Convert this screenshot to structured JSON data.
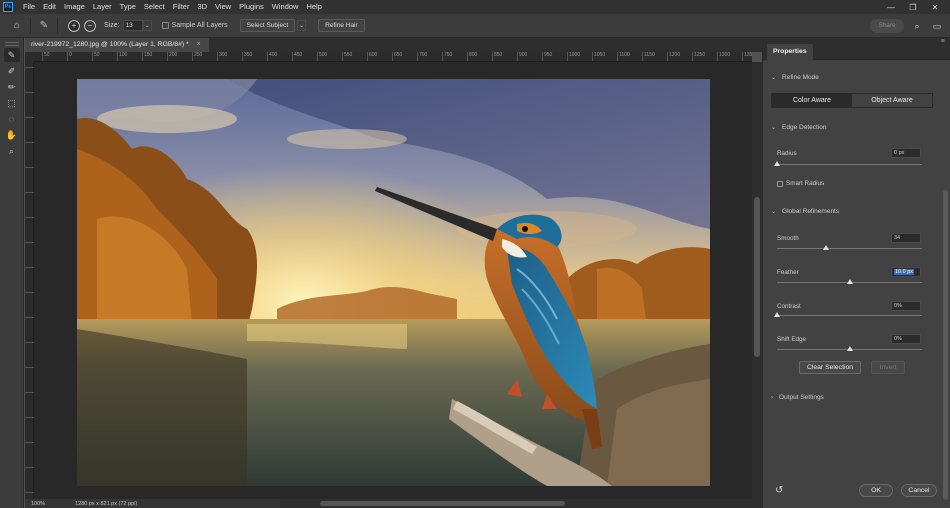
{
  "menu": {
    "logo": "Ps",
    "items": [
      "File",
      "Edit",
      "Image",
      "Layer",
      "Type",
      "Select",
      "Filter",
      "3D",
      "View",
      "Plugins",
      "Window",
      "Help"
    ],
    "minimize": "—",
    "maximize": "❐",
    "close": "✕"
  },
  "options": {
    "size_label": "Size:",
    "size_value": "13",
    "sample_all_layers": "Sample All Layers",
    "select_subject": "Select Subject",
    "refine_hair": "Refine Hair",
    "share": "Share"
  },
  "document": {
    "tab_title": "river-219972_1280.jpg @ 100% (Layer 1, RGB/8#) *",
    "close": "×",
    "zoom": "100%",
    "dimensions": "1280 px x 821 px (72 ppi)"
  },
  "ruler_ticks": [
    "50",
    "0",
    "50",
    "100",
    "150",
    "200",
    "250",
    "300",
    "350",
    "400",
    "450",
    "500",
    "550",
    "600",
    "650",
    "700",
    "750",
    "800",
    "850",
    "900",
    "950",
    "1000",
    "1050",
    "1100",
    "1150",
    "1200",
    "1250",
    "1300",
    "1350"
  ],
  "properties": {
    "tab": "Properties",
    "refine_mode": {
      "title": "Refine Mode",
      "options": [
        "Color Aware",
        "Object Aware"
      ],
      "selected": "Color Aware"
    },
    "edge_detection": {
      "title": "Edge Detection",
      "radius_label": "Radius",
      "radius_value": "0 px",
      "radius_level": 0,
      "smart_radius_label": "Smart Radius"
    },
    "global_refinements": {
      "title": "Global Refinements",
      "smooth_label": "Smooth",
      "smooth_value": "34",
      "smooth_level": 0.34,
      "feather_label": "Feather",
      "feather_value": "10.0 px",
      "feather_level": 0.5,
      "contrast_label": "Contrast",
      "contrast_value": "0%",
      "contrast_level": 0,
      "shift_edge_label": "Shift Edge",
      "shift_edge_value": "0%",
      "shift_edge_level": 0.5
    },
    "clear_selection": "Clear Selection",
    "invert": "Invert",
    "output_settings": "Output Settings",
    "ok": "OK",
    "cancel": "Cancel"
  }
}
